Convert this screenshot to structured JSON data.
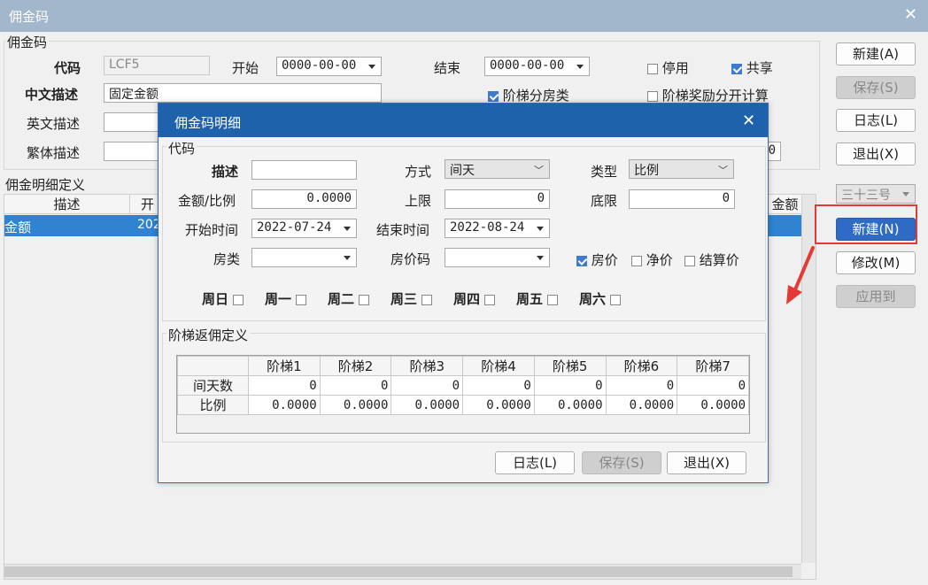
{
  "window": {
    "title": "佣金码",
    "close": "✕"
  },
  "main": {
    "group_title": "佣金码",
    "code_label": "代码",
    "code_value": "LCF5",
    "start_label": "开始",
    "start_value": "0000-00-00",
    "end_label": "结束",
    "end_value": "0000-00-00",
    "disable_label": "停用",
    "share_label": "共享",
    "cn_desc_label": "中文描述",
    "cn_desc_value": "固定金额",
    "step_room_label": "阶梯分房类",
    "step_reward_label": "阶梯奖励分开计算",
    "en_desc_label": "英文描述",
    "tw_desc_label": "繁体描述",
    "partial_value": "0"
  },
  "detail_def": {
    "title": "佣金明细定义",
    "col_desc": "描述",
    "col_start_partial": "开",
    "col_amount_partial": "金额",
    "row_desc": "金额",
    "row_start_partial": "202"
  },
  "side_buttons": {
    "new": "新建(A)",
    "save": "保存(S)",
    "log": "日志(L)",
    "exit": "退出(X)",
    "combo": "三十三号",
    "new2": "新建(N)",
    "modify": "修改(M)",
    "apply": "应用到"
  },
  "dialog": {
    "title": "佣金码明细",
    "close": "✕",
    "group_title": "代码",
    "desc_label": "描述",
    "method_label": "方式",
    "method_value": "间天",
    "type_label": "类型",
    "type_value": "比例",
    "amount_label": "金额/比例",
    "amount_value": "0.0000",
    "upper_label": "上限",
    "upper_value": "0",
    "lower_label": "底限",
    "lower_value": "0",
    "start_time_label": "开始时间",
    "start_time_value": "2022-07-24",
    "end_time_label": "结束时间",
    "end_time_value": "2022-08-24",
    "room_price_label": "房价",
    "net_price_label": "净价",
    "settle_price_label": "结算价",
    "room_type_label": "房类",
    "room_code_label": "房价码",
    "weekdays": [
      "周日",
      "周一",
      "周二",
      "周三",
      "周四",
      "周五",
      "周六"
    ],
    "step_group_title": "阶梯返佣定义",
    "step_headers": [
      "阶梯1",
      "阶梯2",
      "阶梯3",
      "阶梯4",
      "阶梯5",
      "阶梯6",
      "阶梯7"
    ],
    "row_days_label": "间天数",
    "row_days": [
      "0",
      "0",
      "0",
      "0",
      "0",
      "0",
      "0"
    ],
    "row_ratio_label": "比例",
    "row_ratio": [
      "0.0000",
      "0.0000",
      "0.0000",
      "0.0000",
      "0.0000",
      "0.0000",
      "0.0000"
    ],
    "btn_log": "日志(L)",
    "btn_save": "保存(S)",
    "btn_exit": "退出(X)"
  },
  "colors": {
    "titlebar": "#a3b7cc",
    "dialog_title": "#1e62ac",
    "selection": "#2f83d0",
    "highlight_border": "#e53935",
    "arrow": "#e53935"
  }
}
